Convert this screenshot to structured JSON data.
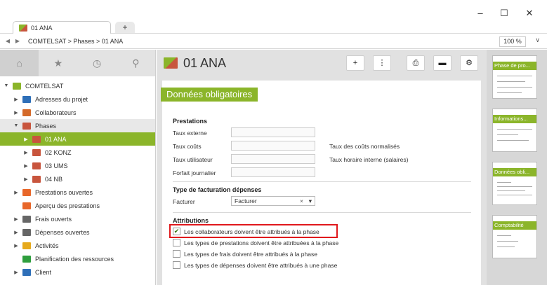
{
  "window": {
    "tab_label": "01 ANA",
    "new_tab_label": "+",
    "minimize": "–",
    "maximize": "☐",
    "close": "✕"
  },
  "address": {
    "back": "◀",
    "forward": "▶",
    "breadcrumb": "COMTELSAT > Phases > 01 ANA",
    "zoom": "100 %",
    "zoom_dropdown": "∨"
  },
  "sidebar": {
    "tools": [
      "⌂",
      "★",
      "◷",
      "⚲"
    ],
    "items": [
      {
        "label": "COMTELSAT",
        "caret": "▼",
        "indent": 0,
        "color": "#8bb52a"
      },
      {
        "label": "Adresses du projet",
        "caret": "▶",
        "indent": 1,
        "color": "#2e6fb8"
      },
      {
        "label": "Collaborateurs",
        "caret": "▶",
        "indent": 1,
        "color": "#d46a2a"
      },
      {
        "label": "Phases",
        "caret": "▼",
        "indent": 1,
        "color": "#c8553d"
      },
      {
        "label": "01 ANA",
        "caret": "▶",
        "indent": 2,
        "color": "#c8553d"
      },
      {
        "label": "02 KONZ",
        "caret": "▶",
        "indent": 2,
        "color": "#c8553d"
      },
      {
        "label": "03 UMS",
        "caret": "▶",
        "indent": 2,
        "color": "#c8553d"
      },
      {
        "label": "04 NB",
        "caret": "▶",
        "indent": 2,
        "color": "#c8553d"
      },
      {
        "label": "Prestations ouvertes",
        "caret": "▶",
        "indent": 1,
        "color": "#e8672a"
      },
      {
        "label": "Aperçu des prestations",
        "caret": "",
        "indent": 1,
        "color": "#e8672a"
      },
      {
        "label": "Frais ouverts",
        "caret": "▶",
        "indent": 1,
        "color": "#666666"
      },
      {
        "label": "Dépenses ouvertes",
        "caret": "▶",
        "indent": 1,
        "color": "#666666"
      },
      {
        "label": "Activités",
        "caret": "▶",
        "indent": 1,
        "color": "#e6a91c"
      },
      {
        "label": "Planification des ressources",
        "caret": "",
        "indent": 1,
        "color": "#2e9e3d"
      },
      {
        "label": "Client",
        "caret": "▶",
        "indent": 1,
        "color": "#2e6fb8"
      }
    ]
  },
  "main": {
    "title": "01 ANA",
    "toolbar": [
      "+",
      "⋮",
      "⎙",
      "▬",
      "⚙"
    ],
    "ribbon": "Données obligatoires",
    "prestations": {
      "heading": "Prestations",
      "fields": [
        "Taux externe",
        "Taux coûts",
        "Taux utilisateur",
        "Forfait journalier"
      ],
      "right_labels": [
        "Taux des coûts normalisés",
        "Taux horaire interne (salaires)"
      ]
    },
    "facturation": {
      "heading": "Type de facturation dépenses",
      "label": "Facturer",
      "value": "Facturer",
      "clear": "×",
      "dropdown": "▾"
    },
    "attributions": {
      "heading": "Attributions",
      "checkboxes": [
        {
          "label": "Les collaborateurs doivent être attribués à la phase",
          "checked": true
        },
        {
          "label": "Les types de prestations doivent être attribuées à la phase",
          "checked": false
        },
        {
          "label": "Les types de frais doivent être attribués à la phase",
          "checked": false
        },
        {
          "label": "Les types de dépenses doivent être attribués à une phase",
          "checked": false
        }
      ]
    }
  },
  "thumbnails": [
    "Phase de pro...",
    "Informations...",
    "Données obli...",
    "Comptabilité"
  ],
  "colors": {
    "accent": "#8bb52a",
    "highlight": "#e0181c"
  }
}
